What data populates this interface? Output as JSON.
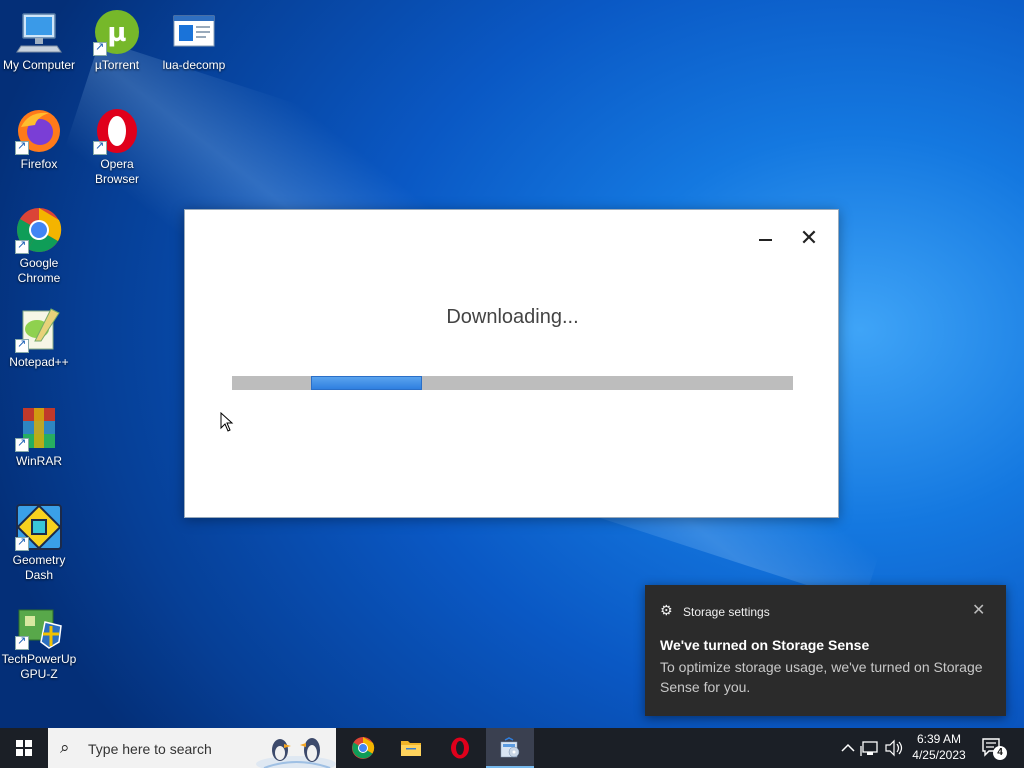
{
  "desktop": {
    "icons": [
      {
        "label": "My Computer",
        "icon": "computer-icon"
      },
      {
        "label": "µTorrent",
        "icon": "utorrent-icon"
      },
      {
        "label": "lua-decomp",
        "icon": "file-icon"
      },
      {
        "label": "Firefox",
        "icon": "firefox-icon"
      },
      {
        "label": "Opera Browser",
        "icon": "opera-icon"
      },
      {
        "label": "Google Chrome",
        "icon": "chrome-icon"
      },
      {
        "label": "Notepad++",
        "icon": "notepadpp-icon"
      },
      {
        "label": "WinRAR",
        "icon": "winrar-icon"
      },
      {
        "label": "Geometry Dash",
        "icon": "geometry-dash-icon"
      },
      {
        "label": "TechPowerUp GPU-Z",
        "icon": "gpuz-icon"
      }
    ]
  },
  "dialog": {
    "status": "Downloading...",
    "progress_indeterminate": true,
    "minimize_icon": "minimize-icon",
    "close_icon": "close-icon"
  },
  "toast": {
    "app": "Storage settings",
    "title": "We've turned on Storage Sense",
    "body": "To optimize storage usage, we've turned on Storage Sense for you.",
    "icon": "gear-icon"
  },
  "taskbar": {
    "search_placeholder": "Type here to search",
    "apps": [
      "chrome-icon",
      "file-explorer-icon",
      "opera-icon",
      "installer-icon"
    ],
    "time": "6:39 AM",
    "date": "4/25/2023",
    "notification_count": "4"
  },
  "colors": {
    "accent": "#2f7fe0",
    "progress_track": "#bdbdbd",
    "toast_bg": "#2b2b2b",
    "taskbar_bg": "#1b1f26"
  }
}
